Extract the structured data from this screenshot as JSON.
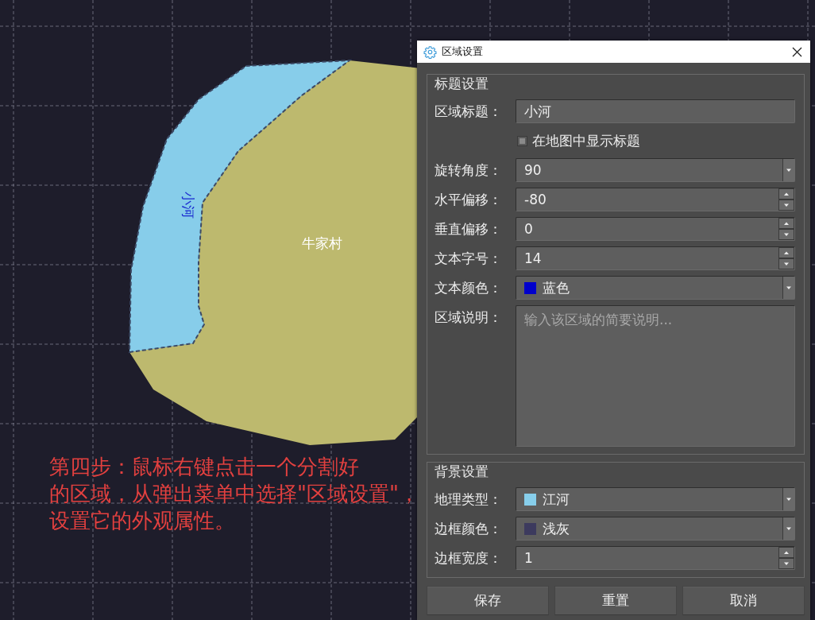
{
  "map": {
    "regions": [
      {
        "kind": "village",
        "label": "牛家村",
        "color": "#bdb96e"
      },
      {
        "kind": "river",
        "label": "小河",
        "color": "#87cdea"
      }
    ],
    "annotation_lines": [
      "第四步：鼠标右键点击一个分割好",
      "的区域，从弹出菜单中选择\"区域设置\"，",
      "设置它的外观属性。"
    ]
  },
  "dialog": {
    "title": "区域设置",
    "groups": [
      {
        "title": "标题设置",
        "rows": [
          {
            "kind": "text",
            "label": "区域标题：",
            "value": "小河"
          },
          {
            "kind": "checkbox",
            "text": "在地图中显示标题",
            "checked": false
          },
          {
            "kind": "combo",
            "label": "旋转角度：",
            "value": "90"
          },
          {
            "kind": "spin",
            "label": "水平偏移：",
            "value": "-80"
          },
          {
            "kind": "spin",
            "label": "垂直偏移：",
            "value": "0"
          },
          {
            "kind": "spin",
            "label": "文本字号：",
            "value": "14"
          },
          {
            "kind": "combo",
            "label": "文本颜色：",
            "value": "蓝色",
            "color": "#0000cc"
          },
          {
            "kind": "textarea",
            "label": "区域说明：",
            "placeholder": "输入该区域的简要说明..."
          }
        ]
      },
      {
        "title": "背景设置",
        "rows": [
          {
            "kind": "combo",
            "label": "地理类型：",
            "value": "江河",
            "color": "#87ceeb"
          },
          {
            "kind": "combo",
            "label": "边框颜色：",
            "value": "浅灰",
            "color": "#3c3a5e"
          },
          {
            "kind": "spin",
            "label": "边框宽度：",
            "value": "1"
          }
        ]
      }
    ],
    "buttons": [
      "保存",
      "重置",
      "取消"
    ]
  }
}
